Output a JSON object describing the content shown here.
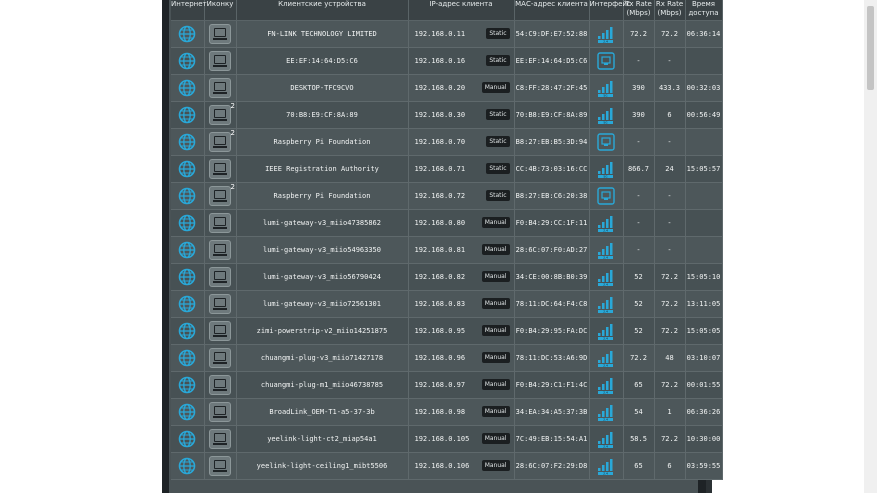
{
  "colors": {
    "accent": "#29a8d8",
    "panel": "#4a5356",
    "header": "#3a4245",
    "badge": "#1b1f21"
  },
  "table": {
    "headers": {
      "internet": "Интернет",
      "icon": "Иконку",
      "device": "Клиентские устройства",
      "ip": "IP-адрес клиента",
      "mac": "МАС-адрес клиента",
      "iface": "Интерфейс",
      "tx": "Tx Rate (Mbps)",
      "rx": "Rx Rate (Mbps)",
      "time": "Время доступа"
    },
    "rows": [
      {
        "name": "FN-LINK TECHNOLOGY LIMITED",
        "ip": "192.168.0.11",
        "mode": "Static",
        "mac": "54:C9:DF:E7:52:88",
        "iface": "wifi-2g-icon",
        "tx": "72.2",
        "rx": "72.2",
        "time": "06:36:14",
        "count": ""
      },
      {
        "name": "EE:EF:14:64:D5:C6",
        "ip": "192.168.0.16",
        "mode": "Static",
        "mac": "EE:EF:14:64:D5:C6",
        "iface": "wired-icon",
        "tx": "-",
        "rx": "-",
        "time": "",
        "count": ""
      },
      {
        "name": "DESKTOP-TFC9CVO",
        "ip": "192.168.0.20",
        "mode": "Manual",
        "mac": "C8:FF:28:47:2F:45",
        "iface": "wifi-5g-icon",
        "tx": "390",
        "rx": "433.3",
        "time": "00:32:03",
        "count": ""
      },
      {
        "name": "70:B8:E9:CF:8A:89",
        "ip": "192.168.0.30",
        "mode": "Static",
        "mac": "70:B8:E9:CF:8A:89",
        "iface": "wifi-5g-icon",
        "tx": "390",
        "rx": "6",
        "time": "00:56:49",
        "count": "2"
      },
      {
        "name": "Raspberry Pi Foundation",
        "ip": "192.168.0.70",
        "mode": "Static",
        "mac": "B8:27:EB:B5:3D:94",
        "iface": "wired-icon",
        "tx": "-",
        "rx": "-",
        "time": "",
        "count": "2"
      },
      {
        "name": "IEEE Registration Authority",
        "ip": "192.168.0.71",
        "mode": "Static",
        "mac": "CC:4B:73:03:16:CC",
        "iface": "wifi-5g-icon",
        "tx": "866.7",
        "rx": "24",
        "time": "15:05:57",
        "count": ""
      },
      {
        "name": "Raspberry Pi Foundation",
        "ip": "192.168.0.72",
        "mode": "Static",
        "mac": "B8:27:EB:C6:20:38",
        "iface": "wired-icon",
        "tx": "-",
        "rx": "-",
        "time": "",
        "count": "2"
      },
      {
        "name": "lumi-gateway-v3_miio47385862",
        "ip": "192.168.0.80",
        "mode": "Manual",
        "mac": "F0:B4:29:CC:1F:11",
        "iface": "wifi-2g-icon",
        "tx": "-",
        "rx": "-",
        "time": "",
        "count": ""
      },
      {
        "name": "lumi-gateway-v3_miio54963350",
        "ip": "192.168.0.81",
        "mode": "Manual",
        "mac": "28:6C:07:F0:AD:27",
        "iface": "wifi-2g-icon",
        "tx": "-",
        "rx": "-",
        "time": "",
        "count": ""
      },
      {
        "name": "lumi-gateway-v3_miio56790424",
        "ip": "192.168.0.82",
        "mode": "Manual",
        "mac": "34:CE:00:8B:B0:39",
        "iface": "wifi-2g-icon",
        "tx": "52",
        "rx": "72.2",
        "time": "15:05:10",
        "count": ""
      },
      {
        "name": "lumi-gateway-v3_miio72561301",
        "ip": "192.168.0.83",
        "mode": "Manual",
        "mac": "78:11:DC:64:F4:C8",
        "iface": "wifi-2g-icon",
        "tx": "52",
        "rx": "72.2",
        "time": "13:11:05",
        "count": ""
      },
      {
        "name": "zimi-powerstrip-v2_miio14251875",
        "ip": "192.168.0.95",
        "mode": "Manual",
        "mac": "F0:B4:29:95:FA:DC",
        "iface": "wifi-2g-icon",
        "tx": "52",
        "rx": "72.2",
        "time": "15:05:05",
        "count": ""
      },
      {
        "name": "chuangmi-plug-v3_miio71427178",
        "ip": "192.168.0.96",
        "mode": "Manual",
        "mac": "78:11:DC:53:A6:9D",
        "iface": "wifi-2g-icon",
        "tx": "72.2",
        "rx": "48",
        "time": "03:10:07",
        "count": ""
      },
      {
        "name": "chuangmi-plug-m1_miio46738785",
        "ip": "192.168.0.97",
        "mode": "Manual",
        "mac": "F0:B4:29:C1:F1:4C",
        "iface": "wifi-2g-icon",
        "tx": "65",
        "rx": "72.2",
        "time": "00:01:55",
        "count": ""
      },
      {
        "name": "BroadLink_OEM-T1-a5-37-3b",
        "ip": "192.168.0.98",
        "mode": "Manual",
        "mac": "34:EA:34:A5:37:3B",
        "iface": "wifi-2g-icon",
        "tx": "54",
        "rx": "1",
        "time": "06:36:26",
        "count": ""
      },
      {
        "name": "yeelink-light-ct2_miap54a1",
        "ip": "192.168.0.105",
        "mode": "Manual",
        "mac": "7C:49:EB:15:54:A1",
        "iface": "wifi-2g-icon",
        "tx": "58.5",
        "rx": "72.2",
        "time": "10:30:00",
        "count": ""
      },
      {
        "name": "yeelink-light-ceiling1_mibt5506",
        "ip": "192.168.0.106",
        "mode": "Manual",
        "mac": "28:6C:07:F2:29:D8",
        "iface": "wifi-2g-icon",
        "tx": "65",
        "rx": "6",
        "time": "03:59:55",
        "count": ""
      }
    ]
  }
}
